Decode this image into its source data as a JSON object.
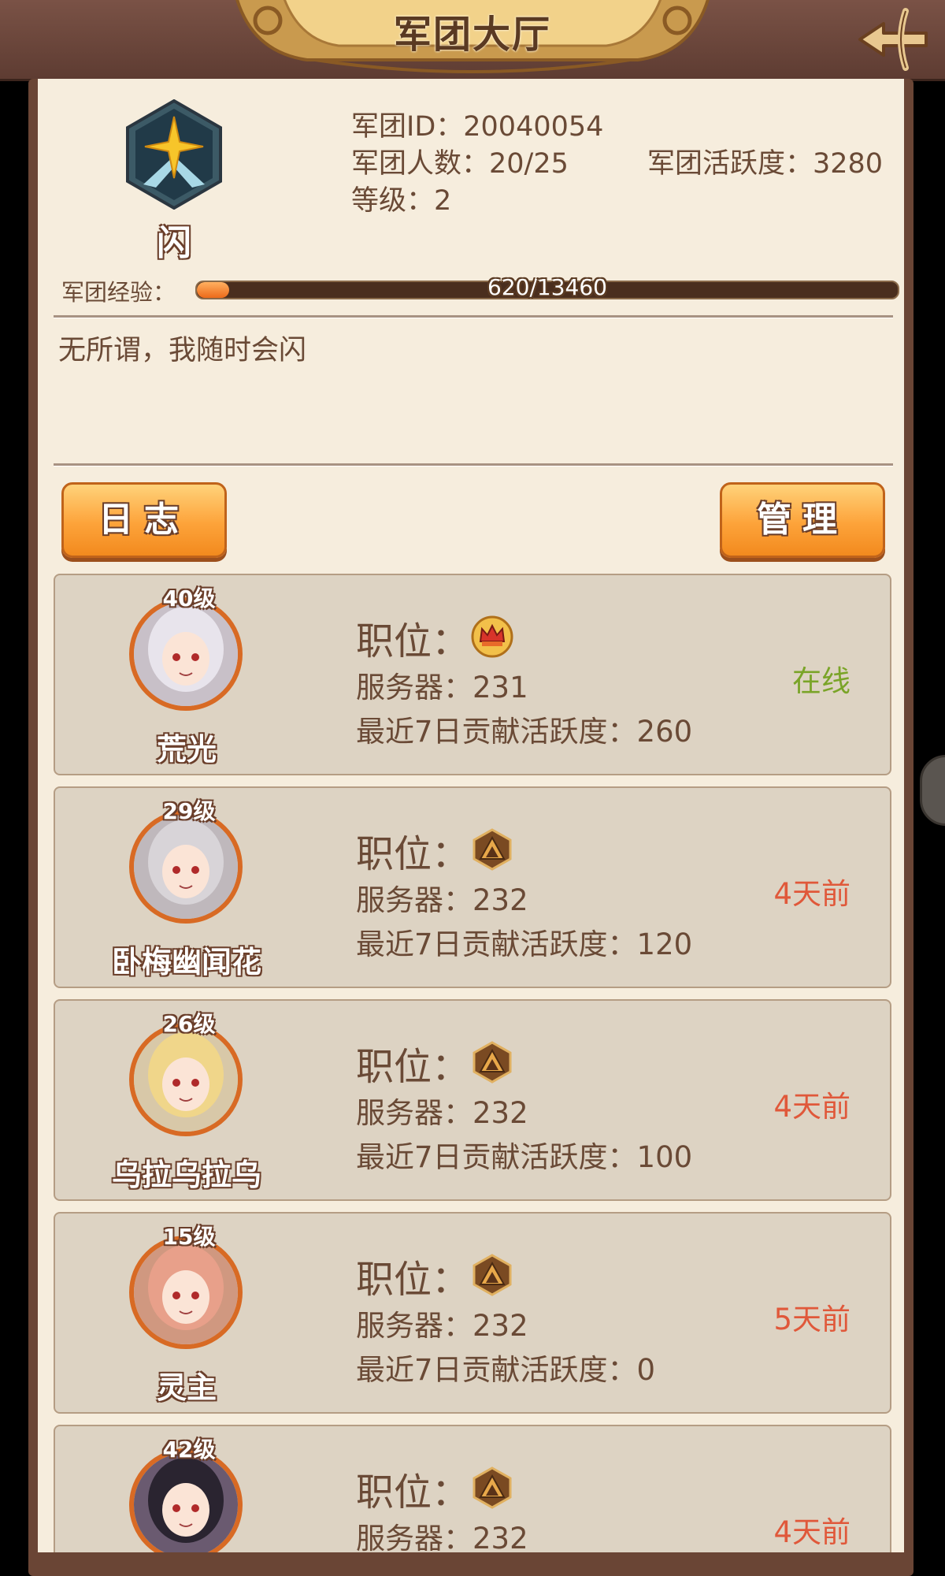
{
  "header": {
    "title": "军团大厅",
    "back_icon": "arrow-back-icon"
  },
  "guild": {
    "emblem_icon": "star-emblem-icon",
    "name": "闪",
    "id_text": "军团ID：20040054",
    "members_text": "军团人数：20/25",
    "activity_text": "军团活跃度：3280",
    "level_text": "等级：2",
    "exp_label": "军团经验：",
    "exp_text": "620/13460",
    "exp_fraction": 0.046,
    "motto": "无所谓，我随时会闪"
  },
  "buttons": {
    "log_label": "日志",
    "manage_label": "管理"
  },
  "colors": {
    "online": "#7aa428",
    "offline": "#e0583a"
  },
  "members": [
    {
      "level": "40级",
      "name": "荒光",
      "position_label": "职位：",
      "position_icon": "crown-leader-icon",
      "server": "服务器：231",
      "activity": "最近7日贡献活跃度：260",
      "status": "在线",
      "online": true
    },
    {
      "level": "29级",
      "name": "卧梅幽闻花",
      "position_label": "职位：",
      "position_icon": "member-rank-icon",
      "server": "服务器：232",
      "activity": "最近7日贡献活跃度：120",
      "status": "4天前",
      "online": false
    },
    {
      "level": "26级",
      "name": "乌拉乌拉乌",
      "position_label": "职位：",
      "position_icon": "member-rank-icon",
      "server": "服务器：232",
      "activity": "最近7日贡献活跃度：100",
      "status": "4天前",
      "online": false
    },
    {
      "level": "15级",
      "name": "灵主",
      "position_label": "职位：",
      "position_icon": "member-rank-icon",
      "server": "服务器：232",
      "activity": "最近7日贡献活跃度：0",
      "status": "5天前",
      "online": false
    },
    {
      "level": "42级",
      "name": "",
      "position_label": "职位：",
      "position_icon": "member-rank-icon",
      "server": "服务器：232",
      "activity": "",
      "status": "4天前",
      "online": false
    }
  ]
}
